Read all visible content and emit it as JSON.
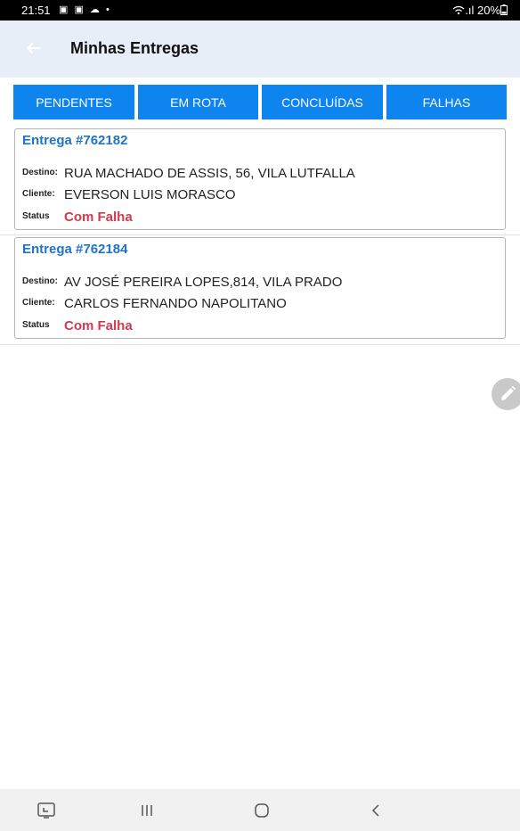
{
  "status_bar": {
    "time": "21:51",
    "notifications": "▣ ▣ ☁ •",
    "right": "WiFi .ıl 20%▮"
  },
  "app_bar": {
    "title": "Minhas Entregas",
    "back_icon": "arrow-left-icon"
  },
  "tabs": [
    {
      "label": "PENDENTES"
    },
    {
      "label": "EM ROTA"
    },
    {
      "label": "CONCLUÍDAS"
    },
    {
      "label": "FALHAS"
    }
  ],
  "deliveries": [
    {
      "title": "Entrega #762182",
      "destino_label": "Destino:",
      "destino": "RUA MACHADO DE ASSIS, 56, VILA LUTFALLA",
      "cliente_label": "Cliente:",
      "cliente": "EVERSON LUIS MORASCO",
      "status_label": "Status",
      "status": "Com Falha"
    },
    {
      "title": "Entrega #762184",
      "destino_label": "Destino:",
      "destino": "AV JOSÉ PEREIRA LOPES,814, VILA PRADO",
      "cliente_label": "Cliente:",
      "cliente": "CARLOS FERNANDO NAPOLITANO",
      "status_label": "Status",
      "status": "Com Falha"
    }
  ],
  "colors": {
    "tab": "#0e84ee",
    "title_blue": "#1f74c7",
    "fail_red": "#d33a4a",
    "app_bar": "#e8eef8"
  },
  "fab": {
    "icon": "pencil-icon"
  },
  "nav_bar": {
    "icons": [
      "screenshot-icon",
      "recent-apps-icon",
      "home-icon",
      "back-icon"
    ]
  }
}
